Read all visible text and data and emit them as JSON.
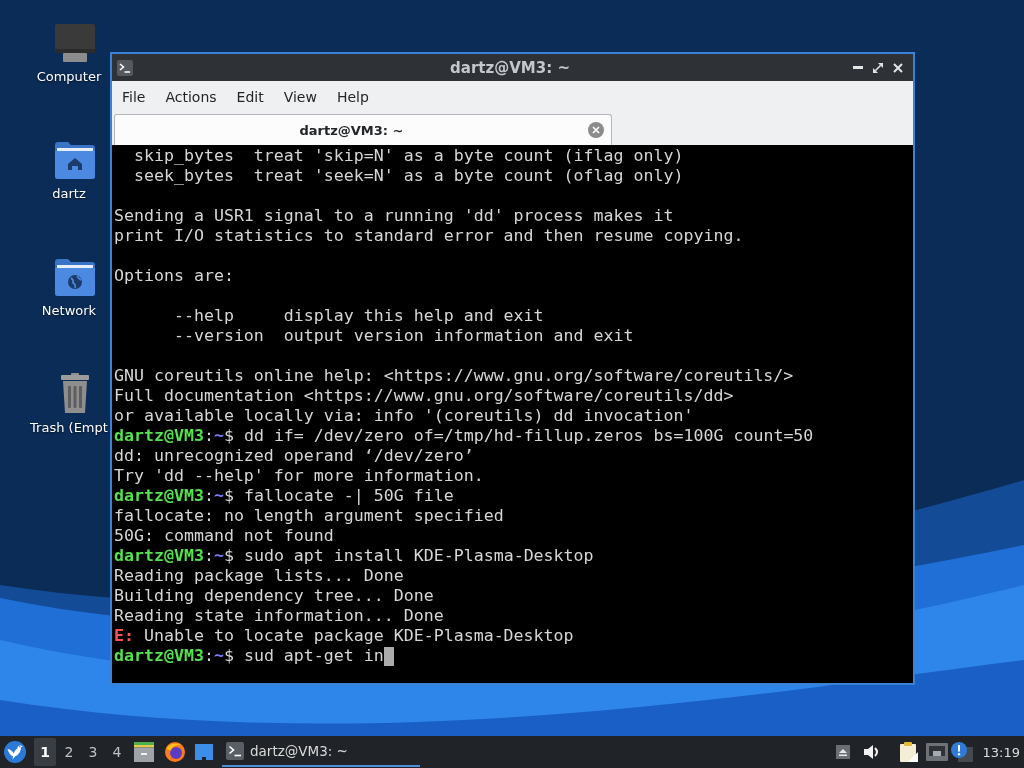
{
  "desktop": {
    "icons": [
      {
        "kind": "computer",
        "label": "Computer"
      },
      {
        "kind": "home",
        "label": "dartz"
      },
      {
        "kind": "network",
        "label": "Network"
      },
      {
        "kind": "trash",
        "label": "Trash (Empt"
      }
    ]
  },
  "window": {
    "title": "dartz@VM3: ~",
    "menu": [
      "File",
      "Actions",
      "Edit",
      "View",
      "Help"
    ],
    "tabs": [
      {
        "label": "dartz@VM3: ~",
        "selected": true
      }
    ],
    "terminal": {
      "lines": [
        {
          "kind": "text",
          "text": "  skip_bytes  treat 'skip=N' as a byte count (iflag only)"
        },
        {
          "kind": "text",
          "text": "  seek_bytes  treat 'seek=N' as a byte count (oflag only)"
        },
        {
          "kind": "blank"
        },
        {
          "kind": "text",
          "text": "Sending a USR1 signal to a running 'dd' process makes it"
        },
        {
          "kind": "text",
          "text": "print I/O statistics to standard error and then resume copying."
        },
        {
          "kind": "blank"
        },
        {
          "kind": "text",
          "text": "Options are:"
        },
        {
          "kind": "blank"
        },
        {
          "kind": "text",
          "text": "      --help     display this help and exit"
        },
        {
          "kind": "text",
          "text": "      --version  output version information and exit"
        },
        {
          "kind": "blank"
        },
        {
          "kind": "text",
          "text": "GNU coreutils online help: <https://www.gnu.org/software/coreutils/>"
        },
        {
          "kind": "text",
          "text": "Full documentation <https://www.gnu.org/software/coreutils/dd>"
        },
        {
          "kind": "text",
          "text": "or available locally via: info '(coreutils) dd invocation'"
        },
        {
          "kind": "prompt",
          "user": "dartz@VM3",
          "separator": ":",
          "path": "~",
          "symbol": "$",
          "command": "dd if= /dev/zero of=/tmp/hd-fillup.zeros bs=100G count=50",
          "cursor": false
        },
        {
          "kind": "text",
          "text": "dd: unrecognized operand ‘/dev/zero’"
        },
        {
          "kind": "text",
          "text": "Try 'dd --help' for more information."
        },
        {
          "kind": "prompt",
          "user": "dartz@VM3",
          "separator": ":",
          "path": "~",
          "symbol": "$",
          "command": "fallocate -| 50G file",
          "cursor": false
        },
        {
          "kind": "text",
          "text": "fallocate: no length argument specified"
        },
        {
          "kind": "text",
          "text": "50G: command not found"
        },
        {
          "kind": "prompt",
          "user": "dartz@VM3",
          "separator": ":",
          "path": "~",
          "symbol": "$",
          "command": "sudo apt install KDE-Plasma-Desktop",
          "cursor": false
        },
        {
          "kind": "text",
          "text": "Reading package lists... Done"
        },
        {
          "kind": "text",
          "text": "Building dependency tree... Done"
        },
        {
          "kind": "text",
          "text": "Reading state information... Done"
        },
        {
          "kind": "error",
          "tag": "E:",
          "text": "Unable to locate package KDE-Plasma-Desktop"
        },
        {
          "kind": "prompt",
          "user": "dartz@VM3",
          "separator": ":",
          "path": "~",
          "symbol": "$",
          "command": "sud apt-get in",
          "cursor": true
        }
      ]
    }
  },
  "taskbar": {
    "workspaces": [
      {
        "label": "1",
        "selected": true
      },
      {
        "label": "2",
        "selected": false
      },
      {
        "label": "3",
        "selected": false
      },
      {
        "label": "4",
        "selected": false
      }
    ],
    "task": {
      "label": "dartz@VM3: ~",
      "active": true
    },
    "clock": "13:19"
  }
}
